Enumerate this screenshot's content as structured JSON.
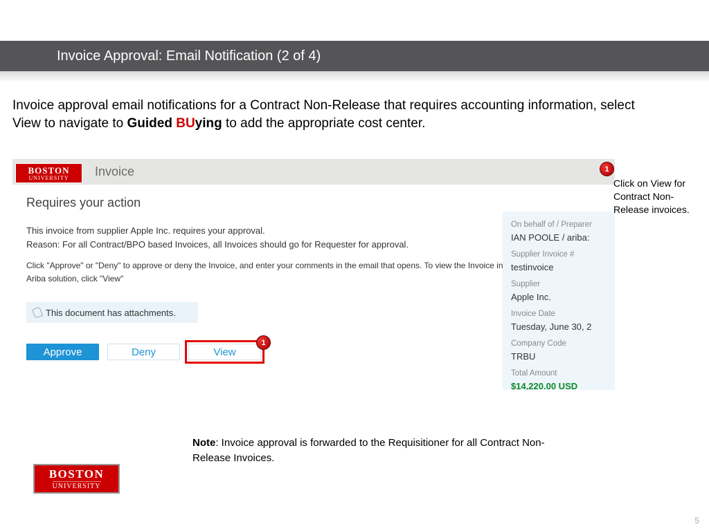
{
  "titlebar": {
    "title": "Invoice Approval: Email Notification (2 of 4)"
  },
  "intro": {
    "text_before": "Invoice approval email notifications for a Contract Non-Release that requires accounting information, select View to navigate to ",
    "guided": "Guided ",
    "bu": "BU",
    "ying": "ying",
    "text_after": " to add the appropriate cost center."
  },
  "email": {
    "logo_top": "BOSTON",
    "logo_bottom": "UNIVERSITY",
    "header_title": "Invoice",
    "action_heading": "Requires your action",
    "para1_l1": "This invoice from supplier Apple Inc. requires your approval.",
    "para1_l2": "Reason: For all Contract/BPO based Invoices, all Invoices should go for Requester for approval.",
    "para2": "Click \"Approve\" or \"Deny\" to approve or deny the Invoice, and enter your comments in the email that opens. To view the Invoice in the Ariba solution, click \"View\"",
    "attach": "This document has attachments.",
    "btn_approve": "Approve",
    "btn_deny": "Deny",
    "btn_view": "View",
    "marker": "1"
  },
  "panel": {
    "lbl1": "On behalf of / Preparer",
    "val1": "IAN POOLE / ariba:",
    "lbl2": "Supplier Invoice #",
    "val2": "testinvoice",
    "lbl3": "Supplier",
    "val3": "Apple Inc.",
    "lbl4": "Invoice Date",
    "val4": "Tuesday, June 30, 2",
    "lbl5": "Company Code",
    "val5": "TRBU",
    "lbl6": "Total Amount",
    "val6": "$14,220.00 USD"
  },
  "callout": {
    "num": "1",
    "text": "Click on View for Contract Non-Release invoices."
  },
  "note": {
    "label": "Note",
    "text": ": Invoice approval is forwarded to the Requisitioner for all Contract Non-Release Invoices."
  },
  "footer": {
    "logo_top": "BOSTON",
    "logo_bottom": "UNIVERSITY",
    "page": "5"
  }
}
